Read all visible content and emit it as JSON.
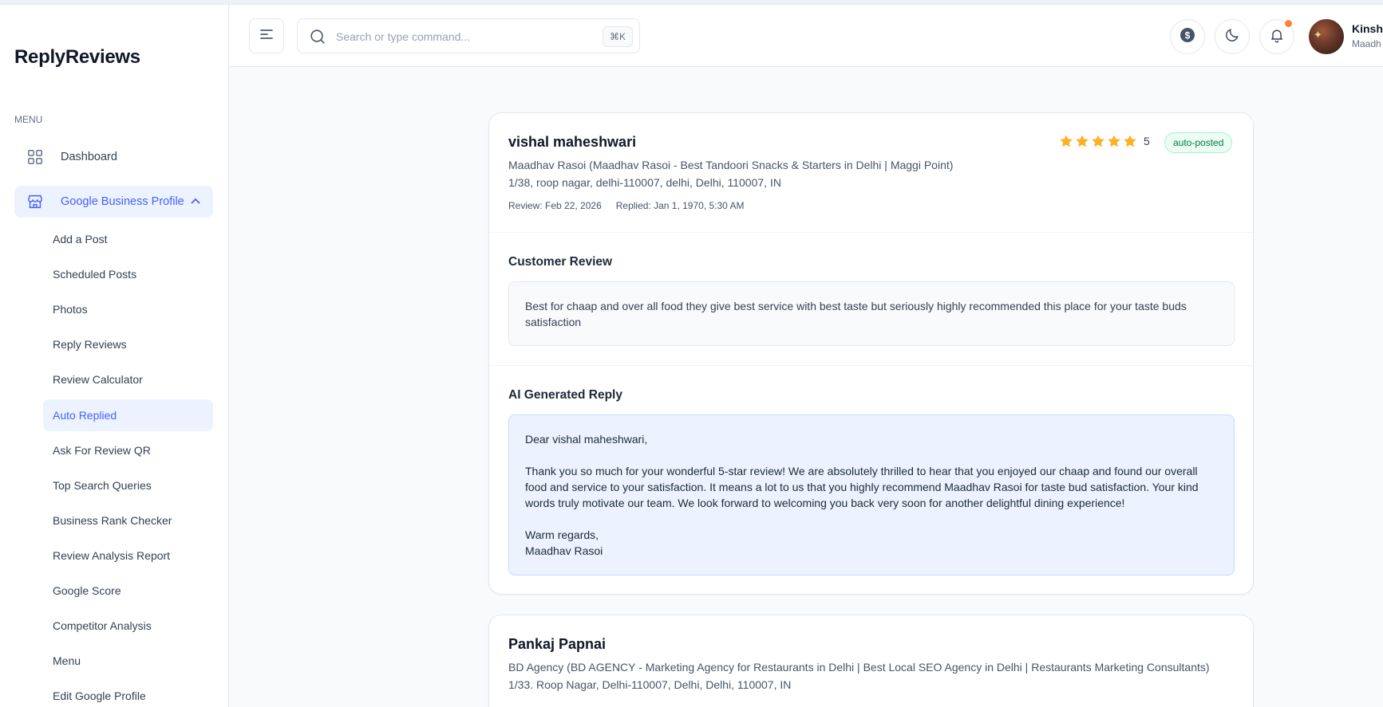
{
  "app": {
    "brand": "ReplyReviews"
  },
  "sidebar": {
    "menu_label": "MENU",
    "dashboard": "Dashboard",
    "gbp": "Google Business Profile",
    "sub_items": [
      "Add a Post",
      "Scheduled Posts",
      "Photos",
      "Reply Reviews",
      "Review Calculator",
      "Auto Replied",
      "Ask For Review QR",
      "Top Search Queries",
      "Business Rank Checker",
      "Review Analysis Report",
      "Google Score",
      "Competitor Analysis",
      "Menu",
      "Edit Google Profile"
    ],
    "active_sub": "Auto Replied"
  },
  "header": {
    "search_placeholder": "Search or type command...",
    "search_shortcut": "⌘K",
    "user_name": "Kinshu",
    "user_business": "Maadh"
  },
  "colors": {
    "accent": "#465fff",
    "accent_bg": "#ecf3ff",
    "star": "#fdb022",
    "badge_green": "#067647",
    "notification_dot": "#fd853a"
  },
  "reviews": [
    {
      "reviewer": "vishal maheshwari",
      "business": "Maadhav Rasoi (Maadhav Rasoi - Best Tandoori Snacks & Starters in Delhi | Maggi Point)",
      "address": "1/38, roop nagar, delhi-110007, delhi, Delhi, 110007, IN",
      "review_date": "Review: Feb 22, 2026",
      "replied_date": "Replied: Jan 1, 1970, 5:30 AM",
      "rating": "5",
      "rating_value": 5,
      "status": "auto-posted",
      "customer_review_title": "Customer Review",
      "customer_review": "Best for chaap and over all food they give best service with best taste but seriously highly recommended this place for your taste buds satisfaction",
      "ai_reply_title": "AI Generated Reply",
      "ai_reply": {
        "greeting": "Dear vishal maheshwari,",
        "body": "Thank you so much for your wonderful 5-star review! We are absolutely thrilled to hear that you enjoyed our chaap and found our overall food and service to your satisfaction. It means a lot to us that you highly recommend Maadhav Rasoi for taste bud satisfaction. Your kind words truly motivate our team. We look forward to welcoming you back very soon for another delightful dining experience!",
        "signoff": "Warm regards,",
        "signature": "Maadhav Rasoi"
      }
    },
    {
      "reviewer": "Pankaj Papnai",
      "business": "BD Agency (BD AGENCY - Marketing Agency for Restaurants in Delhi | Best Local SEO Agency in Delhi | Restaurants Marketing Consultants)",
      "address": "1/33. Roop Nagar, Delhi-110007, Delhi, Delhi, 110007, IN"
    }
  ]
}
